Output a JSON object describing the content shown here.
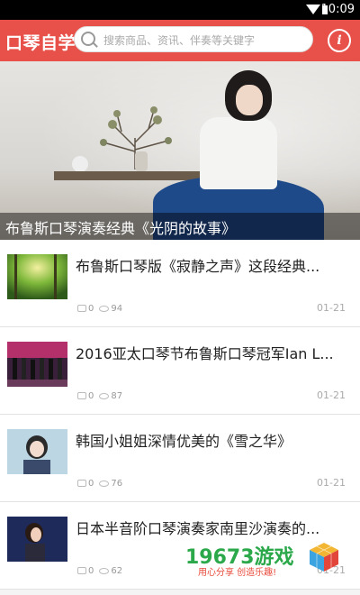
{
  "status": {
    "time": "10:09"
  },
  "header": {
    "logo": "口琴自学",
    "search_placeholder": "搜索商品、资讯、伴奏等关键字",
    "info_label": "i",
    "accent": "#e8514a"
  },
  "banner": {
    "caption": "布鲁斯口琴演奏经典《光阴的故事》"
  },
  "articles": [
    {
      "title": "布鲁斯口琴版《寂静之声》这段经典...",
      "comments": "0",
      "views": "94",
      "date": "01-21"
    },
    {
      "title": "2016亚太口琴节布鲁斯口琴冠军Ian L...",
      "comments": "0",
      "views": "87",
      "date": "01-21"
    },
    {
      "title": "韩国小姐姐深情优美的《雪之华》",
      "comments": "0",
      "views": "76",
      "date": "01-21"
    },
    {
      "title": "日本半音阶口琴演奏家南里沙演奏的...",
      "comments": "0",
      "views": "62",
      "date": "01-21"
    }
  ],
  "watermark": {
    "site": "19673游戏",
    "slogan": "用心分享  创造乐趣!"
  }
}
